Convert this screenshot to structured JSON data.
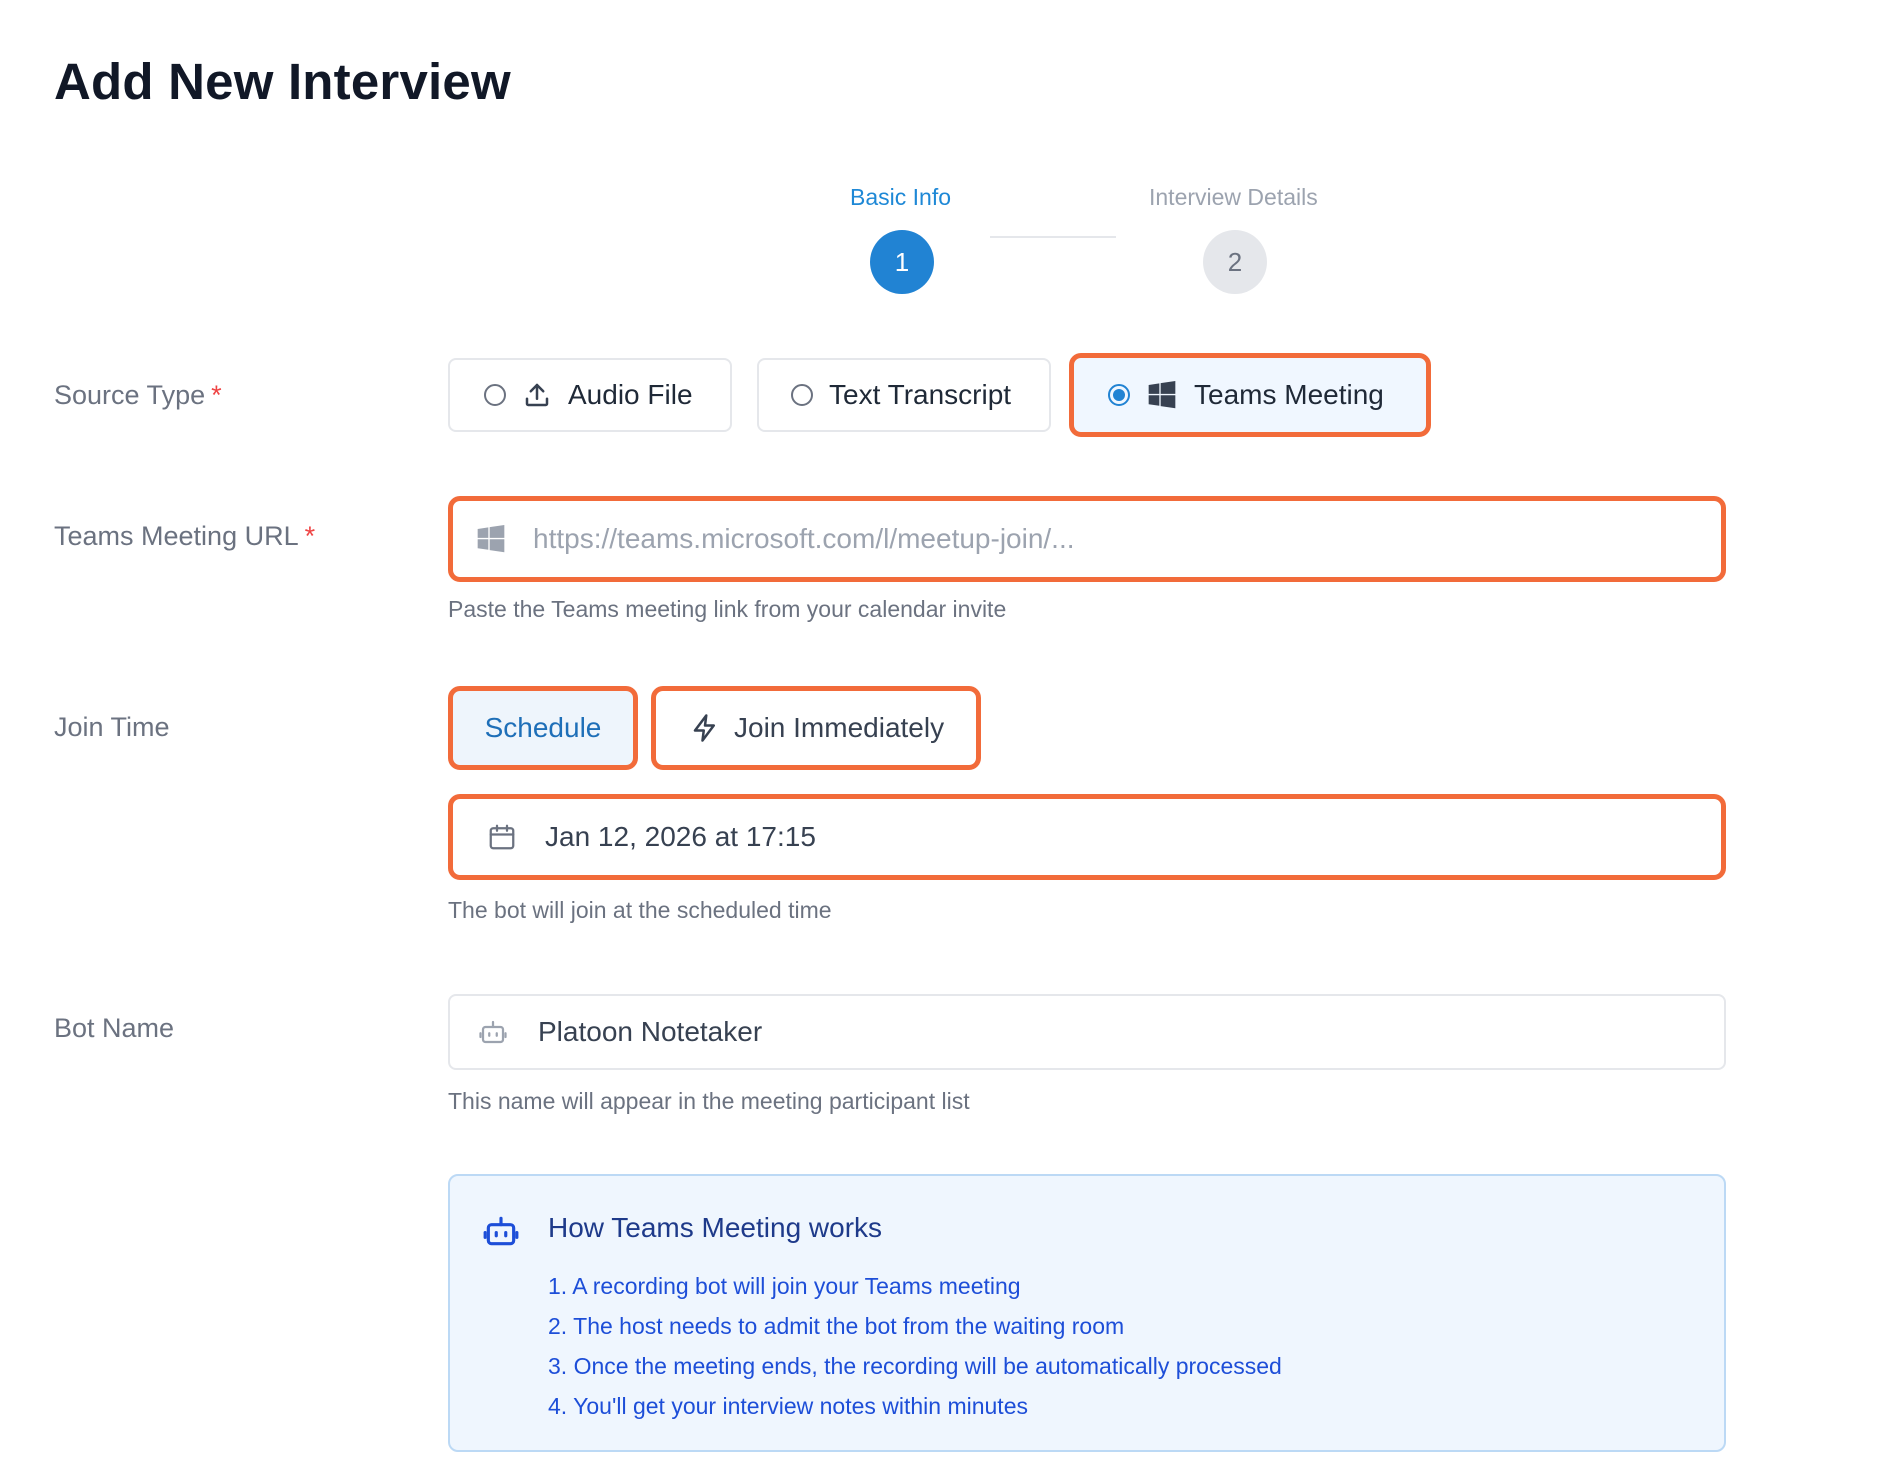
{
  "page": {
    "title": "Add New Interview"
  },
  "stepper": {
    "steps": [
      {
        "label": "Basic Info",
        "number": "1",
        "state": "active"
      },
      {
        "label": "Interview Details",
        "number": "2",
        "state": "inactive"
      }
    ]
  },
  "form": {
    "source_type": {
      "label": "Source Type",
      "required_mark": "*",
      "options": [
        {
          "label": "Audio File",
          "icon": "upload-icon",
          "selected": false
        },
        {
          "label": "Text Transcript",
          "icon": "",
          "selected": false
        },
        {
          "label": "Teams Meeting",
          "icon": "windows-icon",
          "selected": true
        }
      ]
    },
    "teams_url": {
      "label": "Teams Meeting URL",
      "required_mark": "*",
      "placeholder": "https://teams.microsoft.com/l/meetup-join/...",
      "value": "",
      "helper": "Paste the Teams meeting link from your calendar invite"
    },
    "join_time": {
      "label": "Join Time",
      "schedule_label": "Schedule",
      "immediate_label": "Join Immediately",
      "datetime_value": "Jan 12, 2026 at 17:15",
      "helper": "The bot will join at the scheduled time"
    },
    "bot_name": {
      "label": "Bot Name",
      "value": "Platoon Notetaker",
      "helper": "This name will appear in the meeting participant list"
    }
  },
  "info_box": {
    "title": "How Teams Meeting works",
    "items": [
      "1. A recording bot will join your Teams meeting",
      "2. The host needs to admit the bot from the waiting room",
      "3. Once the meeting ends, the recording will be automatically processed",
      "4. You'll get your interview notes within minutes"
    ]
  },
  "colors": {
    "accent": "#2183d3",
    "highlight": "#f26b3a",
    "required": "#ef4444"
  }
}
